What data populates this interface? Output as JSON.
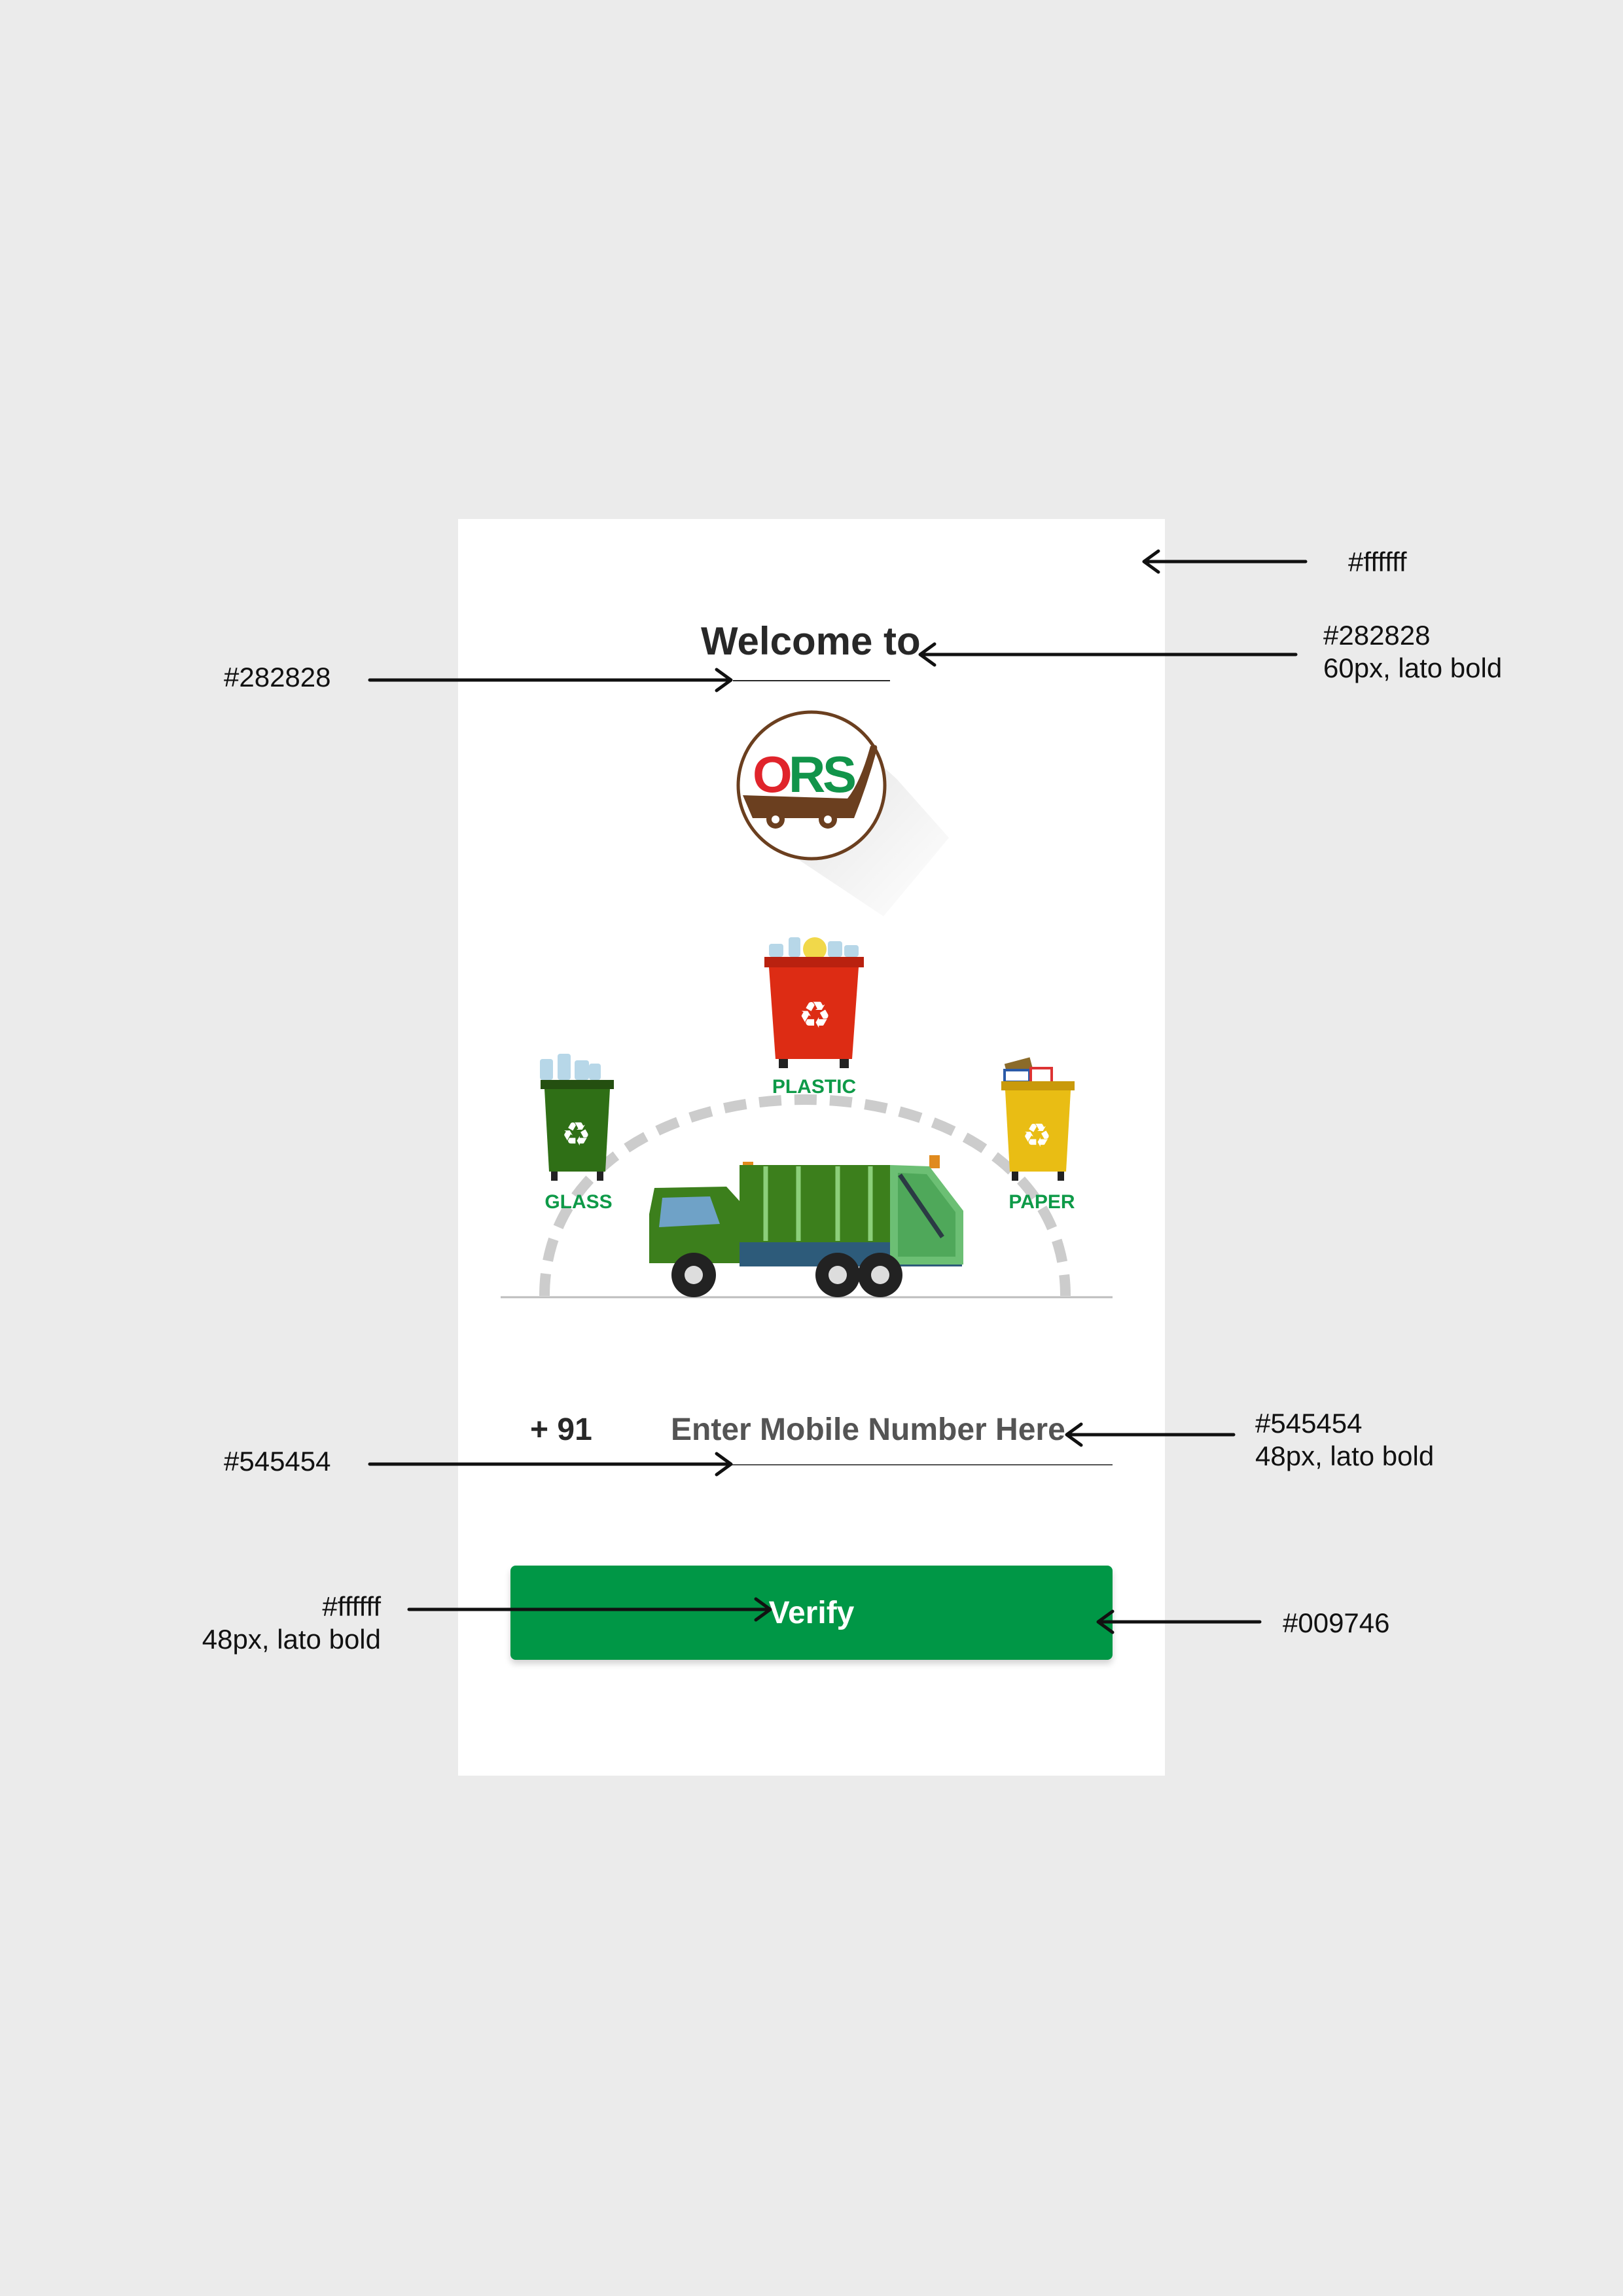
{
  "screen": {
    "welcome_text": "Welcome to",
    "logo_text": "ORS",
    "bins": [
      {
        "label": "PLASTIC"
      },
      {
        "label": "GLASS"
      },
      {
        "label": "PAPER"
      }
    ],
    "country_code": "+ 91",
    "mobile_placeholder": "Enter Mobile Number Here",
    "mobile_value": "",
    "verify_label": "Verify"
  },
  "annotations": {
    "bg_color": "#ffffff",
    "title_color": "#282828",
    "title_font": "60px, lato bold",
    "title_line_color": "#282828",
    "input_text_color": "#545454",
    "input_font": "48px, lato bold",
    "input_line_color": "#545454",
    "button_text_color": "#ffffff",
    "button_text_font": "48px, lato bold",
    "button_bg_color": "#009746"
  },
  "colors": {
    "page_bg": "#ebebeb",
    "card_bg": "#ffffff",
    "title": "#282828",
    "input": "#545454",
    "button": "#009746",
    "logo_brown": "#6b3f1f",
    "logo_red": "#e0242b",
    "logo_green": "#11944a",
    "bin_red": "#dd2c14",
    "bin_green": "#2f6f16",
    "bin_yellow": "#e9bd14",
    "truck_green": "#3c7f1c"
  },
  "icons": [
    "recycle-icon",
    "garbage-truck-icon",
    "ors-cart-logo"
  ]
}
